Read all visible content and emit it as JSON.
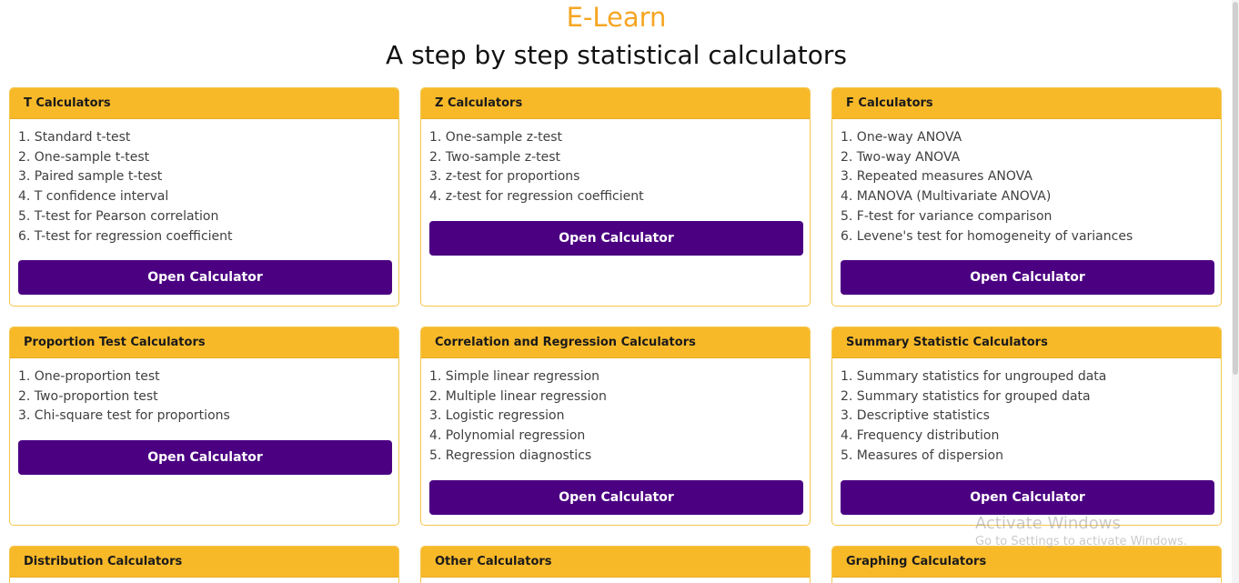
{
  "header": {
    "brand": "E-Learn",
    "subtitle": "A step by step statistical calculators"
  },
  "cards": [
    {
      "title": "T Calculators",
      "items": [
        "1. Standard t-test",
        "2. One-sample t-test",
        "3. Paired sample t-test",
        "4. T confidence interval",
        "5. T-test for Pearson correlation",
        "6. T-test for regression coefficient"
      ],
      "button": "Open Calculator"
    },
    {
      "title": "Z Calculators",
      "items": [
        "1. One-sample z-test",
        "2. Two-sample z-test",
        "3. z-test for proportions",
        "4. z-test for regression coefficient"
      ],
      "button": "Open Calculator"
    },
    {
      "title": "F Calculators",
      "items": [
        "1. One-way ANOVA",
        "2. Two-way ANOVA",
        "3. Repeated measures ANOVA",
        "4. MANOVA (Multivariate ANOVA)",
        "5. F-test for variance comparison",
        "6. Levene's test for homogeneity of variances"
      ],
      "button": "Open Calculator"
    },
    {
      "title": "Proportion Test Calculators",
      "items": [
        "1. One-proportion test",
        "2. Two-proportion test",
        "3. Chi-square test for proportions"
      ],
      "button": "Open Calculator"
    },
    {
      "title": "Correlation and Regression Calculators",
      "items": [
        "1. Simple linear regression",
        "2. Multiple linear regression",
        "3. Logistic regression",
        "4. Polynomial regression",
        "5. Regression diagnostics"
      ],
      "button": "Open Calculator"
    },
    {
      "title": "Summary Statistic Calculators",
      "items": [
        "1. Summary statistics for ungrouped data",
        "2. Summary statistics for grouped data",
        "3. Descriptive statistics",
        "4. Frequency distribution",
        "5. Measures of dispersion"
      ],
      "button": "Open Calculator"
    },
    {
      "title": "Distribution Calculators"
    },
    {
      "title": "Other Calculators"
    },
    {
      "title": "Graphing Calculators"
    }
  ],
  "watermark": {
    "title": "Activate Windows",
    "subtitle": "Go to Settings to activate Windows."
  },
  "colors": {
    "brand": "#f5a623",
    "card_header": "#f8b929",
    "button": "#4b0082"
  }
}
